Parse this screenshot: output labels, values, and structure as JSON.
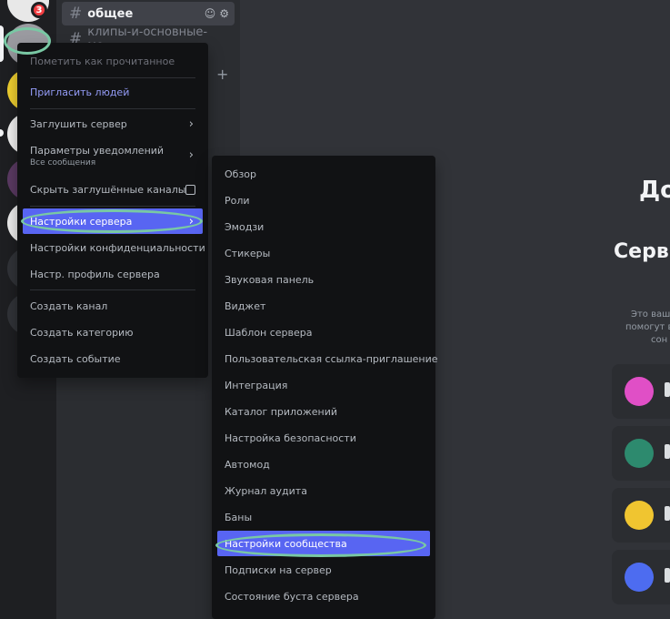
{
  "rail": {
    "badge_count": "3"
  },
  "channels": {
    "active": {
      "name": "общее",
      "icon": "hash-icon"
    },
    "second": {
      "name": "клипы-и-основные-мо...",
      "icon": "hash-icon"
    },
    "add_icon": "+"
  },
  "main": {
    "title": "До",
    "subtitle": "Серв",
    "desc_lines": [
      "Это ваш",
      "помогут в",
      "сон"
    ]
  },
  "server_menu": {
    "items": [
      {
        "label": "Пометить как прочитанное"
      },
      {
        "label": "Пригласить людей"
      },
      {
        "label": "Заглушить сервер"
      },
      {
        "label": "Параметры уведомлений",
        "sub": "Все сообщения"
      },
      {
        "label": "Скрыть заглушённые каналы"
      },
      {
        "label": "Настройки сервера"
      },
      {
        "label": "Настройки конфиденциальности"
      },
      {
        "label": "Настр. профиль сервера"
      },
      {
        "label": "Создать канал"
      },
      {
        "label": "Создать категорию"
      },
      {
        "label": "Создать событие"
      }
    ]
  },
  "settings_submenu": {
    "items": [
      {
        "label": "Обзор"
      },
      {
        "label": "Роли"
      },
      {
        "label": "Эмодзи"
      },
      {
        "label": "Стикеры"
      },
      {
        "label": "Звуковая панель"
      },
      {
        "label": "Виджет"
      },
      {
        "label": "Шаблон сервера"
      },
      {
        "label": "Пользовательская ссылка-приглашение"
      },
      {
        "label": "Интеграция"
      },
      {
        "label": "Каталог приложений"
      },
      {
        "label": "Настройка безопасности"
      },
      {
        "label": "Автомод"
      },
      {
        "label": "Журнал аудита"
      },
      {
        "label": "Баны"
      },
      {
        "label": "Настройки сообщества"
      },
      {
        "label": "Подписки на сервер"
      },
      {
        "label": "Состояние буста сервера"
      }
    ]
  },
  "colors": {
    "highlight": "#5865f2",
    "annotation": "#79c8a4",
    "menu_bg": "#111214",
    "badge": "#f23f43"
  }
}
